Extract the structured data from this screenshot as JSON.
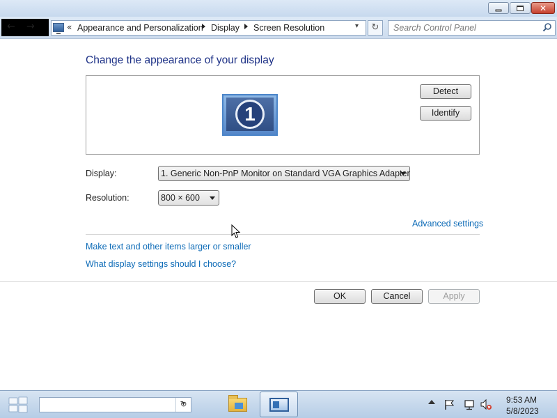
{
  "window": {
    "min_glyph": "",
    "close_glyph": "✕"
  },
  "nav": {
    "back_glyph": "←",
    "forward_glyph": "→",
    "breadcrumb_prefix": "«",
    "breadcrumbs": [
      "Appearance and Personalization",
      "Display",
      "Screen Resolution"
    ],
    "refresh_glyph": "↻",
    "search_placeholder": "Search Control Panel"
  },
  "main": {
    "title": "Change the appearance of your display",
    "monitor_number": "1",
    "detect_label": "Detect",
    "identify_label": "Identify",
    "display_label": "Display:",
    "display_value": "1. Generic Non-PnP Monitor on Standard VGA Graphics Adapter",
    "resolution_label": "Resolution:",
    "resolution_value": "800 × 600",
    "advanced_link": "Advanced settings",
    "link_text_size": "Make text and other items larger or smaller",
    "link_display_help": "What display settings should I choose?"
  },
  "buttons": {
    "ok": "OK",
    "cancel": "Cancel",
    "apply": "Apply"
  },
  "taskbar": {
    "refresh_glyph": "↻",
    "time": "9:53 AM",
    "date": "5/8/2023"
  },
  "icons": {
    "start": "windows-logo-icon",
    "explorer": "folder-icon",
    "control_panel": "control-panel-icon",
    "tray": [
      "show-hidden-icons-icon",
      "action-center-flag-icon",
      "network-icon",
      "volume-muted-icon"
    ]
  }
}
